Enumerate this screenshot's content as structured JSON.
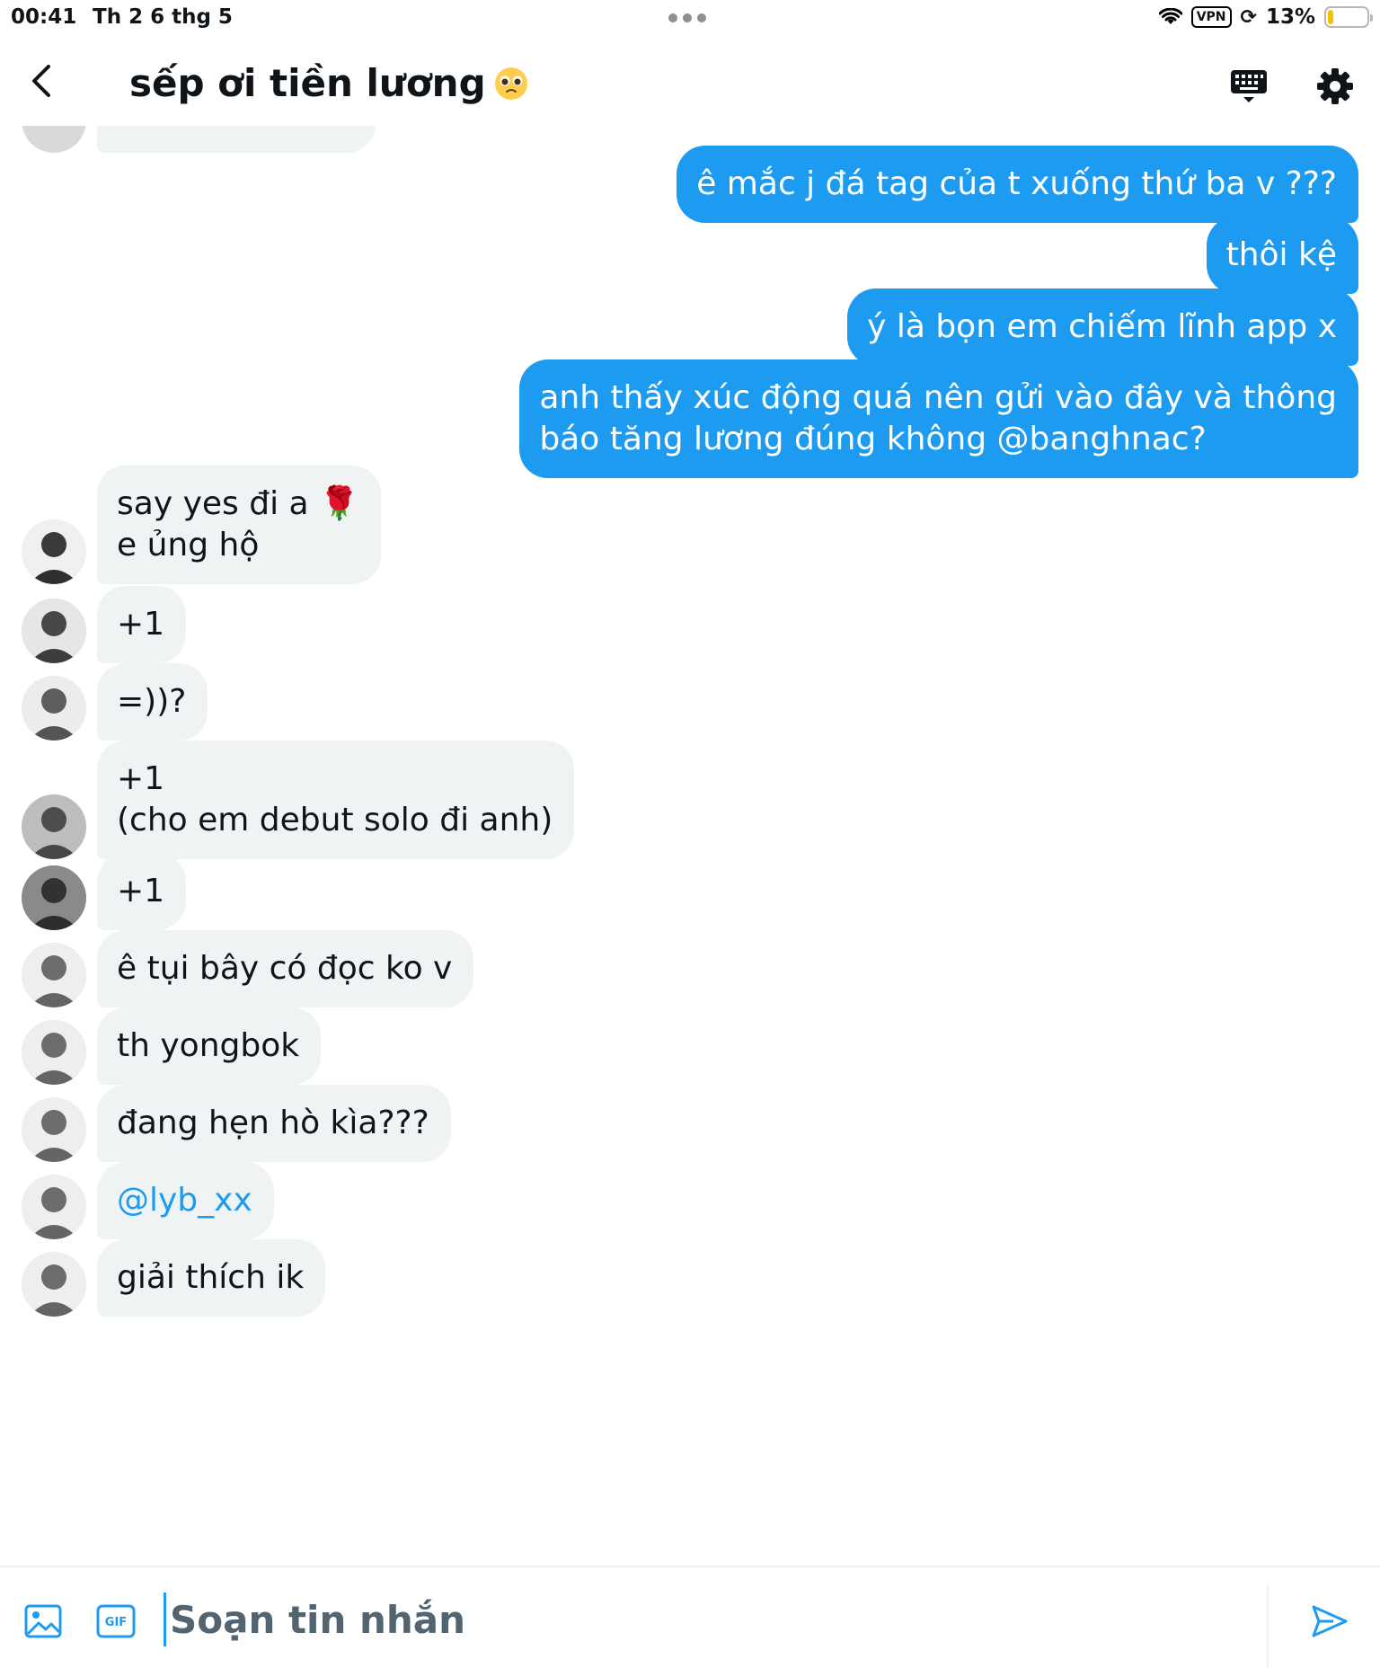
{
  "status_bar": {
    "time": "00:41",
    "date": "Th 2 6 thg 5",
    "vpn": "VPN",
    "battery": "13%",
    "battery_level": 0.13
  },
  "header": {
    "title": "sếp ơi tiền lương"
  },
  "messages": [
    {
      "id": "m1",
      "side": "sent",
      "lines": [
        "ê mắc j đá tag của t xuống thứ ba v ???"
      ]
    },
    {
      "id": "m2",
      "side": "sent",
      "lines": [
        "thôi kệ"
      ]
    },
    {
      "id": "m3",
      "side": "sent",
      "lines": [
        "ý là bọn em chiếm lĩnh app x"
      ]
    },
    {
      "id": "m4",
      "side": "sent",
      "lines": [
        "anh thấy xúc động quá nên gửi vào đây và thông",
        "báo tăng lương đúng không @banghnac?"
      ]
    },
    {
      "id": "m5",
      "side": "received",
      "lines": [
        "say yes đi a 🌹",
        "e ủng hộ"
      ]
    },
    {
      "id": "m6",
      "side": "received",
      "lines": [
        "+1"
      ]
    },
    {
      "id": "m7",
      "side": "received",
      "lines": [
        "=))?"
      ]
    },
    {
      "id": "m8",
      "side": "received",
      "lines": [
        "+1",
        "(cho em debut solo đi anh)"
      ]
    },
    {
      "id": "m9",
      "side": "received",
      "lines": [
        "+1"
      ]
    },
    {
      "id": "m10",
      "side": "received",
      "lines": [
        "ê tụi bây có đọc ko v"
      ]
    },
    {
      "id": "m11",
      "side": "received",
      "lines": [
        "th yongbok"
      ]
    },
    {
      "id": "m12",
      "side": "received",
      "lines": [
        "đang hẹn hò kìa???"
      ]
    },
    {
      "id": "m13",
      "side": "received",
      "lines": [
        "@lyb_xx"
      ]
    },
    {
      "id": "m14",
      "side": "received",
      "lines": [
        "giải thích ik"
      ]
    }
  ],
  "composer": {
    "placeholder": "Soạn tin nhắn",
    "gif_label": "GIF"
  },
  "colors": {
    "accent": "#1d9bf0",
    "received_bubble": "#eff3f4",
    "text": "#0f1419",
    "muted": "#536471"
  }
}
